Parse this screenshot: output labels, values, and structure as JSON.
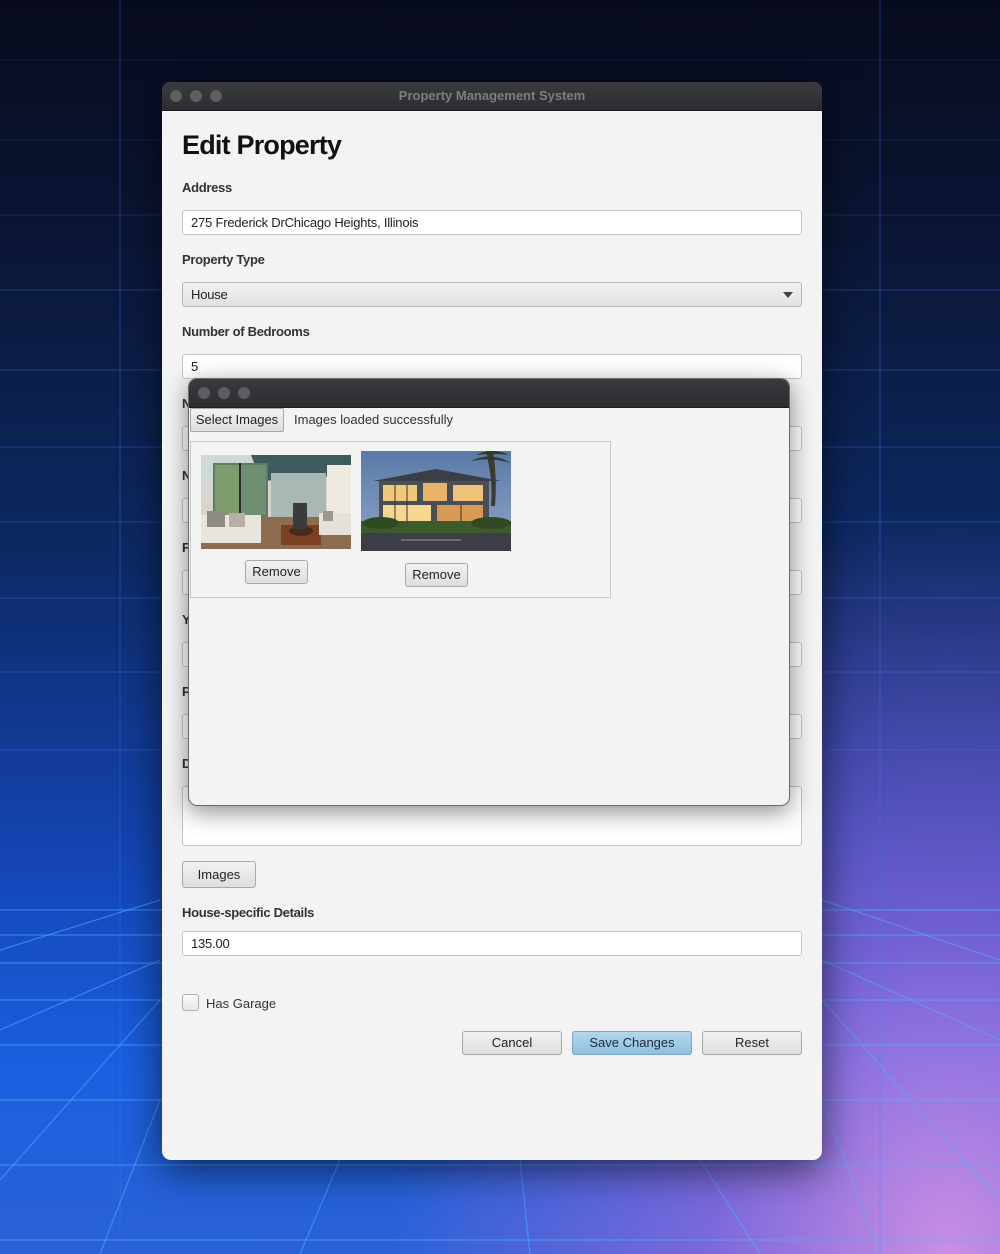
{
  "window": {
    "title": "Property Management System"
  },
  "form": {
    "title": "Edit Property",
    "address_label": "Address",
    "address_value": "275 Frederick DrChicago Heights, Illinois",
    "type_label": "Property Type",
    "type_value": "House",
    "bedrooms_label": "Number of Bedrooms",
    "bedrooms_value": "5",
    "partial_labels": [
      "N",
      "N",
      "F",
      "Y",
      "P",
      "D"
    ],
    "images_button": "Images",
    "house_details_label": "House-specific Details",
    "house_details_value": "135.00",
    "garage_label": "Has Garage",
    "garage_checked": false
  },
  "actions": {
    "cancel": "Cancel",
    "save": "Save Changes",
    "reset": "Reset"
  },
  "dialog": {
    "select_button": "Select Images",
    "status": "Images loaded successfully",
    "images": [
      {
        "icon": "living-room-photo",
        "remove_label": "Remove"
      },
      {
        "icon": "house-exterior-photo",
        "remove_label": "Remove"
      }
    ]
  },
  "colors": {
    "primary_button": "#9dcae6",
    "window_background": "#f3f3f3",
    "titlebar": "#333437"
  }
}
